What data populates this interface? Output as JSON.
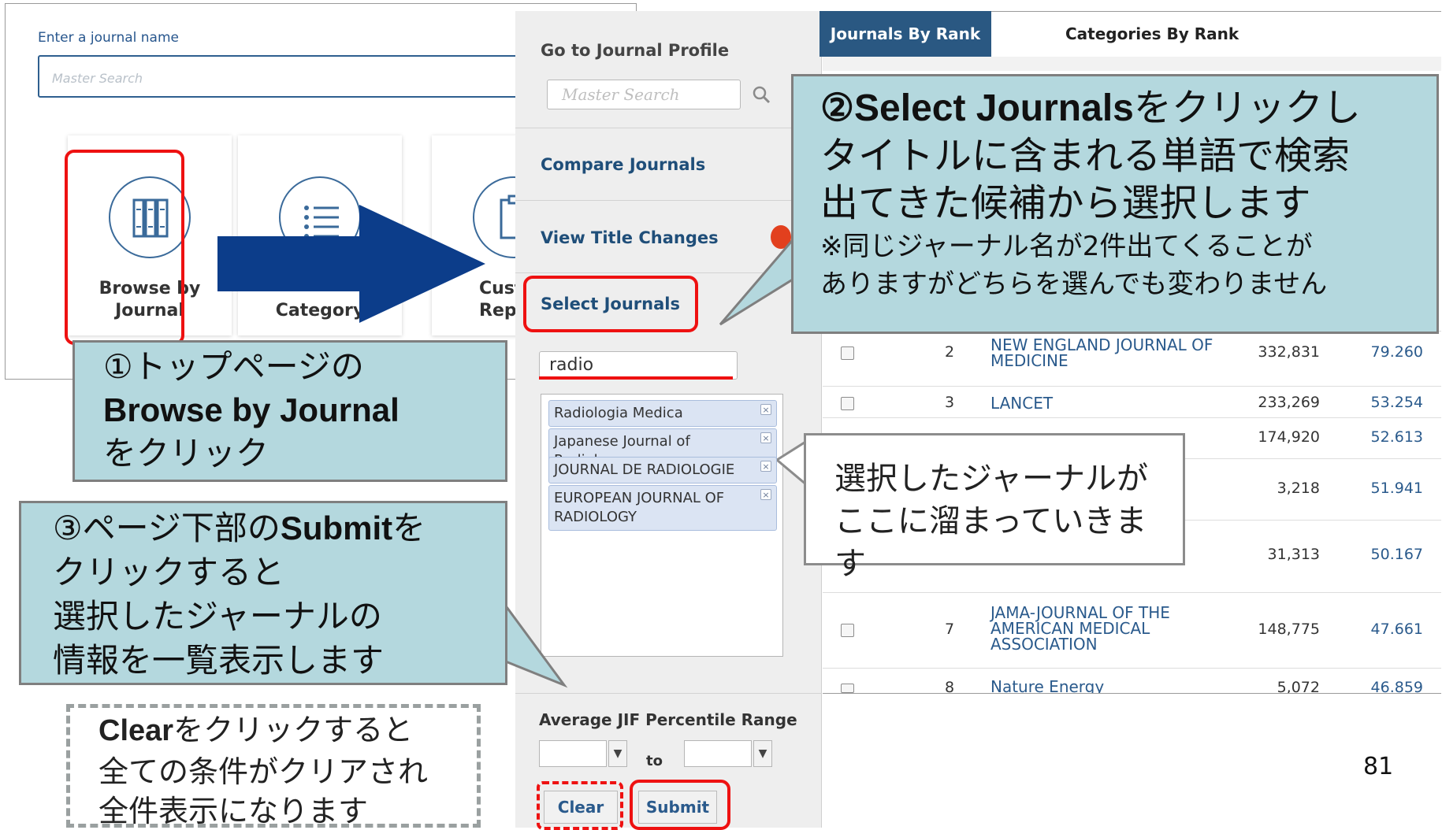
{
  "home": {
    "label": "Enter a journal name",
    "search_placeholder": "Master Search",
    "tiles": [
      {
        "line1": "Browse by",
        "line2": "Journal"
      },
      {
        "line1": "",
        "line2": "Category"
      },
      {
        "line1": "Cust",
        "line2": "Repo"
      }
    ]
  },
  "sidebar": {
    "go_to_profile": "Go to Journal Profile",
    "search_placeholder": "Master Search",
    "compare": "Compare Journals",
    "title_changes": "View Title Changes",
    "select_journals": "Select Journals",
    "search_value": "radio",
    "chosen": [
      "Radiologia Medica",
      "Japanese Journal of Radiology",
      "JOURNAL DE RADIOLOGIE",
      "EUROPEAN JOURNAL OF RADIOLOGY"
    ],
    "chip_remove": "×",
    "range_label": "Average JIF Percentile Range",
    "to": "to",
    "clear": "Clear",
    "submit": "Submit"
  },
  "tabs": {
    "active": "Journals By Rank",
    "other": "Categories By Rank"
  },
  "table": {
    "rows": [
      {
        "rank": "2",
        "name": "NEW ENGLAND JOURNAL OF MEDICINE",
        "name_line1": "NEW ENGLAND JOURNAL OF",
        "name_line2": "MEDICINE",
        "cites": "332,831",
        "jif": "79.260"
      },
      {
        "rank": "3",
        "name_line1": "LANCET",
        "name_line2": "",
        "cites": "233,269",
        "jif": "53.254"
      },
      {
        "rank": "",
        "name_line1": "",
        "name_line2": "",
        "cites": "174,920",
        "jif": "52.613"
      },
      {
        "rank": "",
        "name_line1": "",
        "name_line2": "",
        "cites": "3,218",
        "jif": "51.941"
      },
      {
        "rank": "",
        "name_line1": "",
        "name_line2": "",
        "cites": "31,313",
        "jif": "50.167"
      },
      {
        "rank": "7",
        "name_line1": "JAMA-JOURNAL OF THE",
        "name_line2": "AMERICAN MEDICAL",
        "name_line3": "ASSOCIATION",
        "cites": "148,775",
        "jif": "47.661"
      },
      {
        "rank": "8",
        "name_line1": "Nature Energy",
        "name_line2": "",
        "cites": "5,072",
        "jif": "46.859"
      }
    ]
  },
  "callouts": {
    "step1": {
      "line1": "①トップページの",
      "line2": "Browse by Journal",
      "line3": "をクリック"
    },
    "step2": {
      "line1_bold": "②Select Journals",
      "line1_rest": "をクリックし",
      "line2": "タイトルに含まれる単語で検索",
      "line3": "出てきた候補から選択します",
      "line4": "※同じジャーナル名が2件出てくることが",
      "line5": "ありますがどちらを選んでも変わりません"
    },
    "step3": {
      "line1_a": "③ページ下部の",
      "line1_bold": "Submit",
      "line1_b": "を",
      "line2": "クリックすると",
      "line3": "選択したジャーナルの",
      "line4": "情報を一覧表示します"
    },
    "selected_note": {
      "line1": "選択したジャーナルが",
      "line2": "ここに溜まっていきます"
    },
    "clear_note": {
      "line1_bold": "Clear",
      "line1_rest": "をクリックすると",
      "line2": "全ての条件がクリアされ",
      "line3": "全件表示になります"
    }
  },
  "page_number": "81"
}
